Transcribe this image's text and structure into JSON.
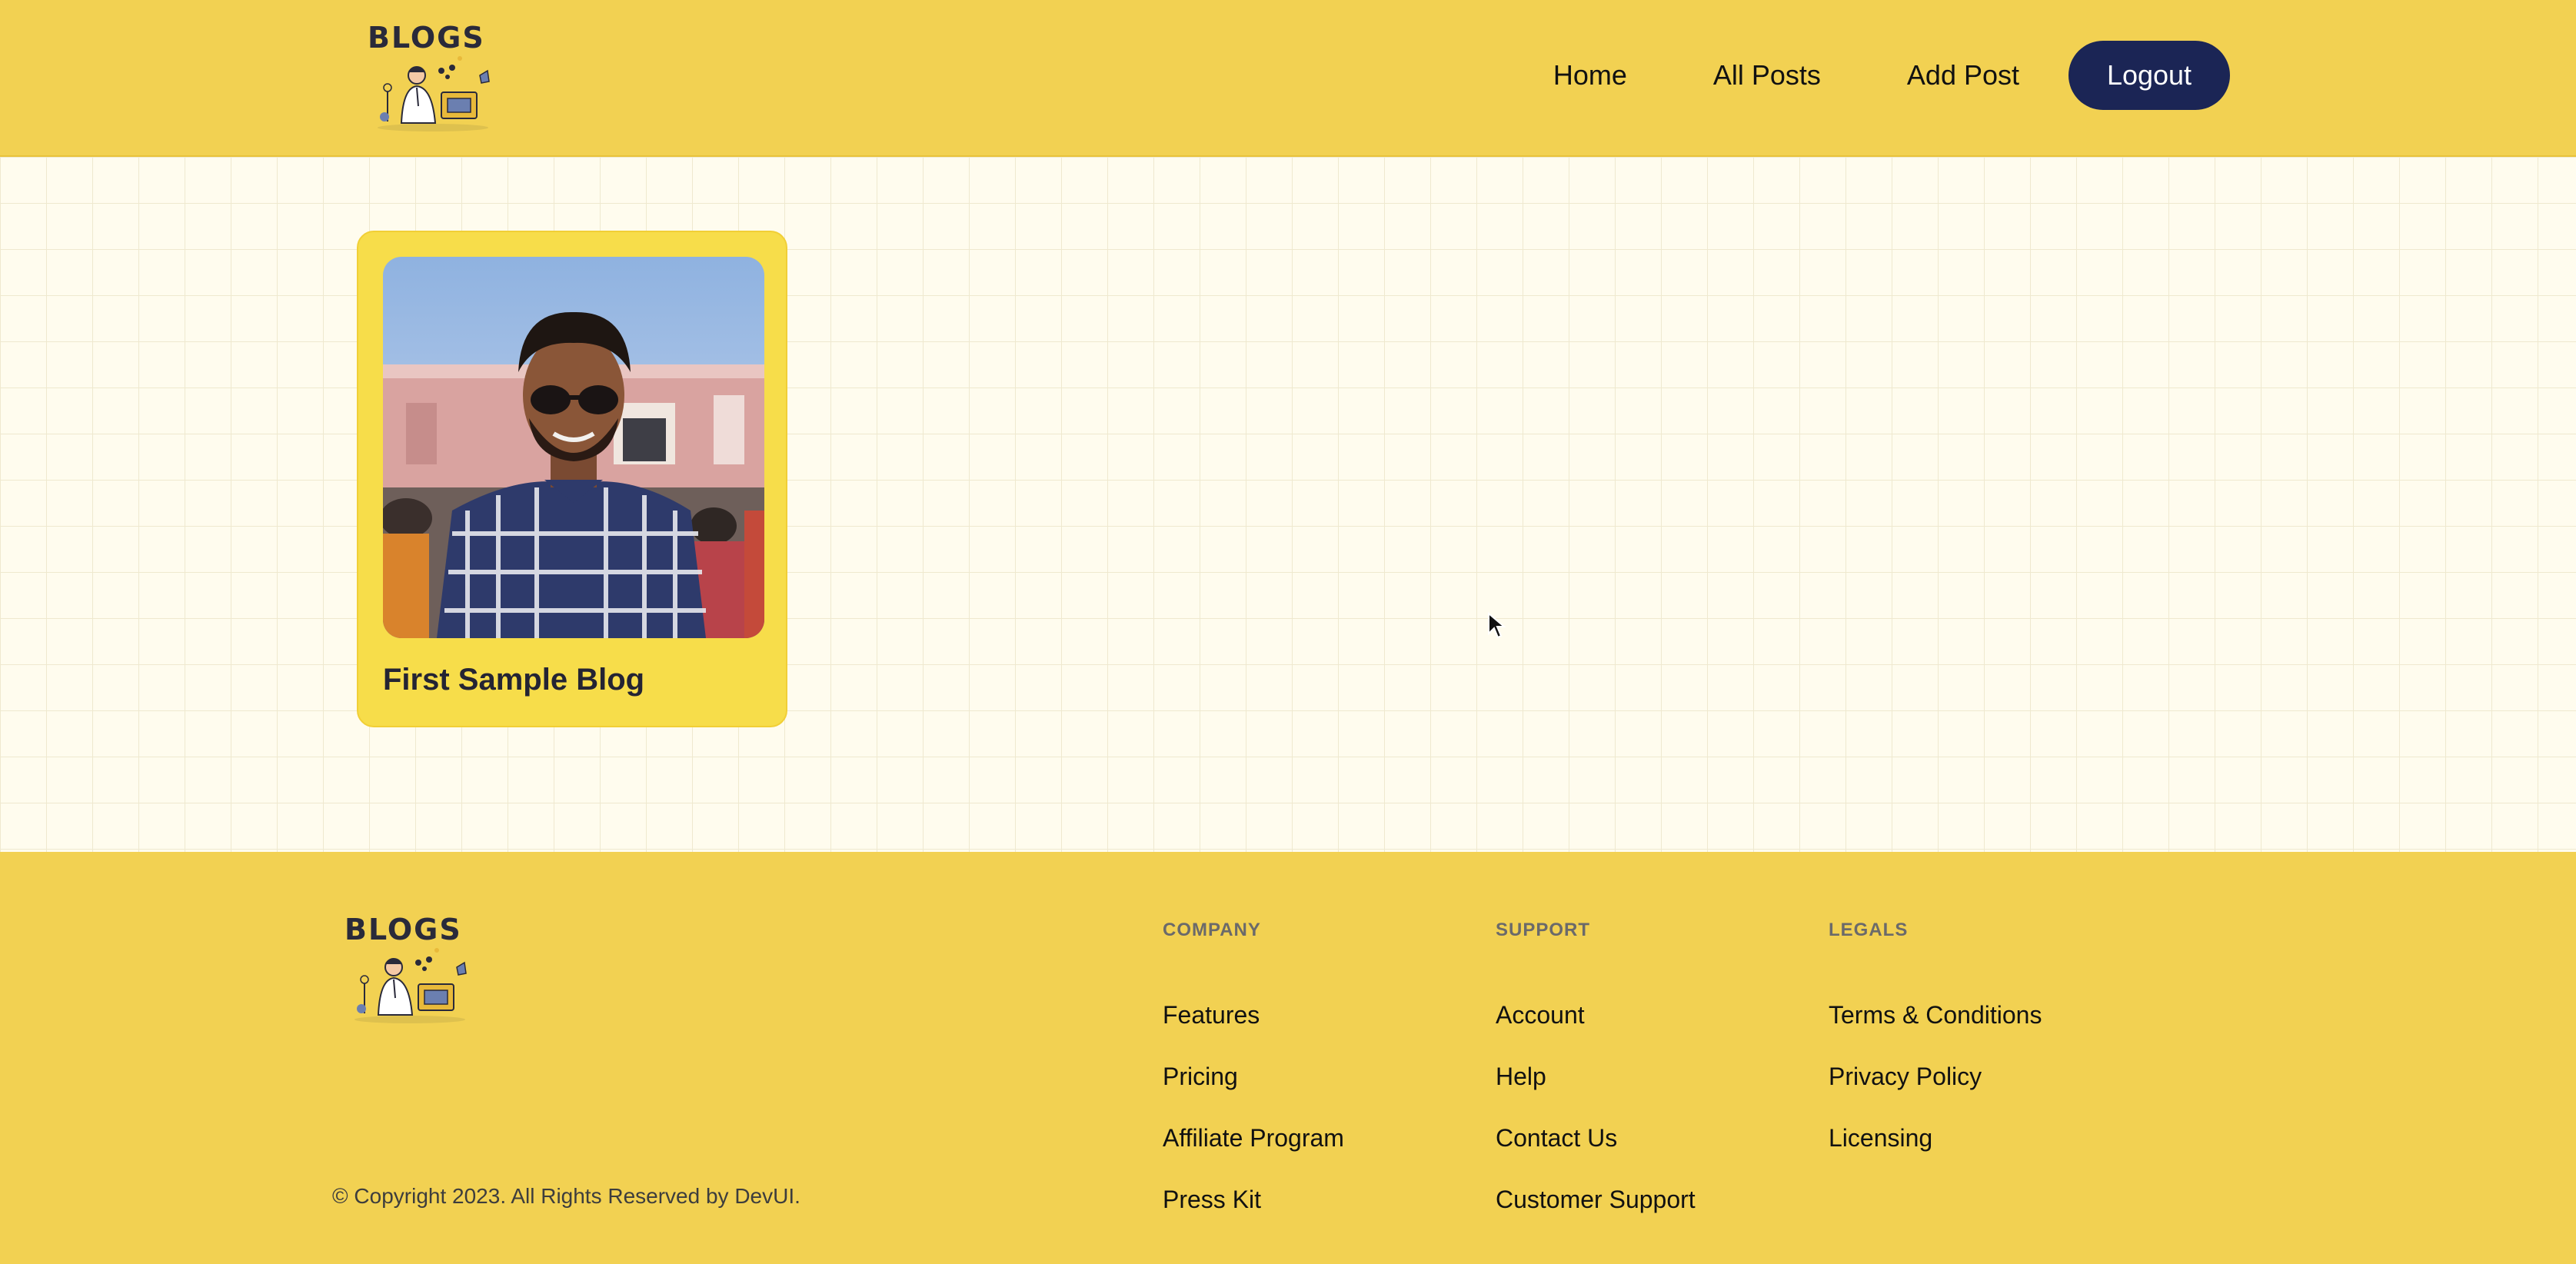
{
  "brand": {
    "logo_text": "BLOGS"
  },
  "nav": {
    "items": [
      "Home",
      "All Posts",
      "Add Post"
    ],
    "logout_label": "Logout"
  },
  "posts": [
    {
      "title": "First Sample Blog",
      "image": "selfie-photo"
    }
  ],
  "footer": {
    "logo_text": "BLOGS",
    "columns": [
      {
        "heading": "COMPANY",
        "links": [
          "Features",
          "Pricing",
          "Affiliate Program",
          "Press Kit"
        ]
      },
      {
        "heading": "SUPPORT",
        "links": [
          "Account",
          "Help",
          "Contact Us",
          "Customer Support"
        ]
      },
      {
        "heading": "LEGALS",
        "links": [
          "Terms & Conditions",
          "Privacy Policy",
          "Licensing"
        ]
      }
    ],
    "copyright": "© Copyright 2023. All Rights Reserved by DevUI."
  },
  "colors": {
    "header_bg": "#f2d152",
    "card_bg": "#f7dd4a",
    "logout_bg": "#1b2555",
    "page_bg": "#fffcee"
  }
}
